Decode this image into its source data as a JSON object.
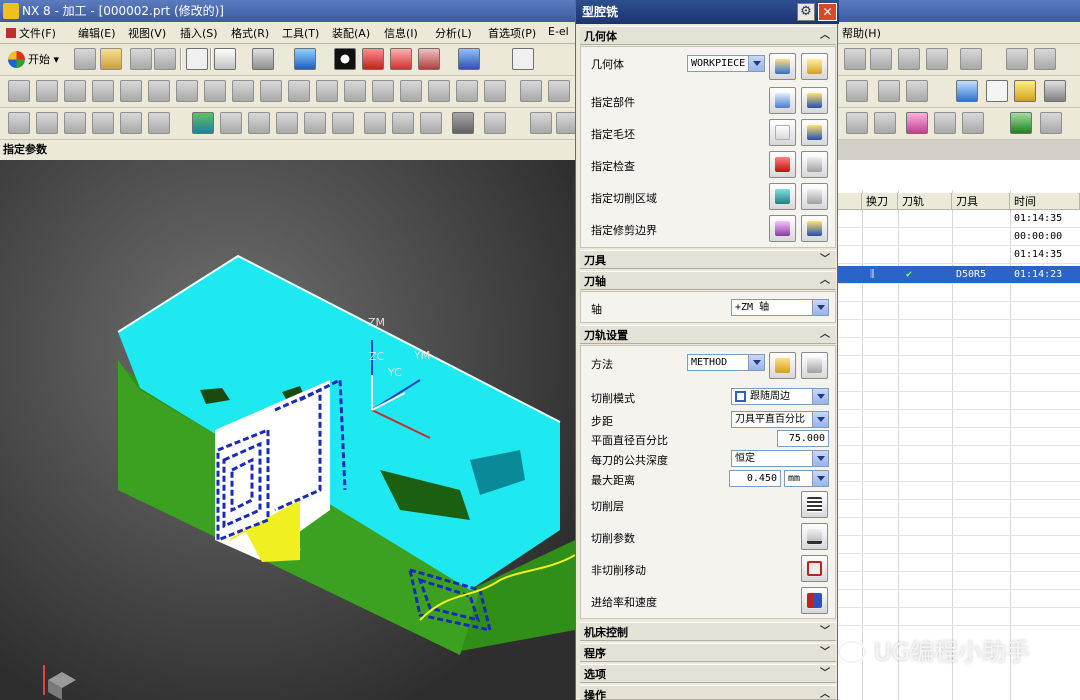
{
  "app": {
    "title": "NX 8 - 加工 - [000002.prt (修改的)]"
  },
  "menu": [
    {
      "label": "文件(F)"
    },
    {
      "label": "编辑(E)"
    },
    {
      "label": "视图(V)"
    },
    {
      "label": "插入(S)"
    },
    {
      "label": "格式(R)"
    },
    {
      "label": "工具(T)"
    },
    {
      "label": "装配(A)"
    },
    {
      "label": "信息(I)"
    },
    {
      "label": "分析(L)"
    },
    {
      "label": "首选项(P)"
    },
    {
      "label": "E-el"
    },
    {
      "label": "帮助(H)"
    }
  ],
  "toolbar": {
    "start_label": "开始"
  },
  "panel": {
    "param_label": "指定参数"
  },
  "viewport": {
    "axis_zm": "ZM",
    "axis_zc": "ZC",
    "axis_ym": "YM",
    "axis_yc": "YC",
    "colors": {
      "top_face": "#1ee8f0",
      "side_wall": "#2f8f18",
      "toolpath": "#1a2ab8",
      "highlight": "#f0f020"
    }
  },
  "navigator": {
    "headers": [
      "换刀",
      "刀轨",
      "刀具",
      "时间"
    ],
    "rows": [
      {
        "toolchange": "",
        "path": "",
        "tool": "",
        "time": "01:14:35",
        "selected": false
      },
      {
        "toolchange": "",
        "path": "",
        "tool": "",
        "time": "00:00:00",
        "selected": false
      },
      {
        "toolchange": "",
        "path": "",
        "tool": "",
        "time": "01:14:35",
        "selected": false
      },
      {
        "toolchange": "",
        "path": "✔",
        "tool": "D50R5",
        "time": "01:14:23",
        "selected": true
      }
    ]
  },
  "dialog": {
    "title": "型腔铣",
    "sections": {
      "geometry": "几何体",
      "tool": "刀具",
      "tool_axis": "刀轴",
      "path_settings": "刀轨设置",
      "machine_control": "机床控制",
      "program": "程序",
      "options": "选项",
      "actions": "操作"
    },
    "geometry": {
      "geometry_label": "几何体",
      "geometry_value": "WORKPIECE",
      "specify_part": "指定部件",
      "specify_blank": "指定毛坯",
      "specify_check": "指定检查",
      "specify_cut_area": "指定切削区域",
      "specify_trim": "指定修剪边界"
    },
    "axis": {
      "label": "轴",
      "value": "+ZM 轴"
    },
    "path": {
      "method_label": "方法",
      "method_value": "METHOD",
      "cut_mode_label": "切削模式",
      "cut_mode_value": "跟随周边",
      "stepover_label": "步距",
      "stepover_value": "刀具平直百分比",
      "flat_percent_label": "平面直径百分比",
      "flat_percent_value": "75.000",
      "depth_label": "每刀的公共深度",
      "depth_value": "恒定",
      "max_distance_label": "最大距离",
      "max_distance_value": "0.450",
      "max_distance_unit": "mm",
      "cut_levels": "切削层",
      "cut_params": "切削参数",
      "non_cut_moves": "非切削移动",
      "feeds_speeds": "进给率和速度"
    }
  },
  "watermark": "UG编程小助手"
}
